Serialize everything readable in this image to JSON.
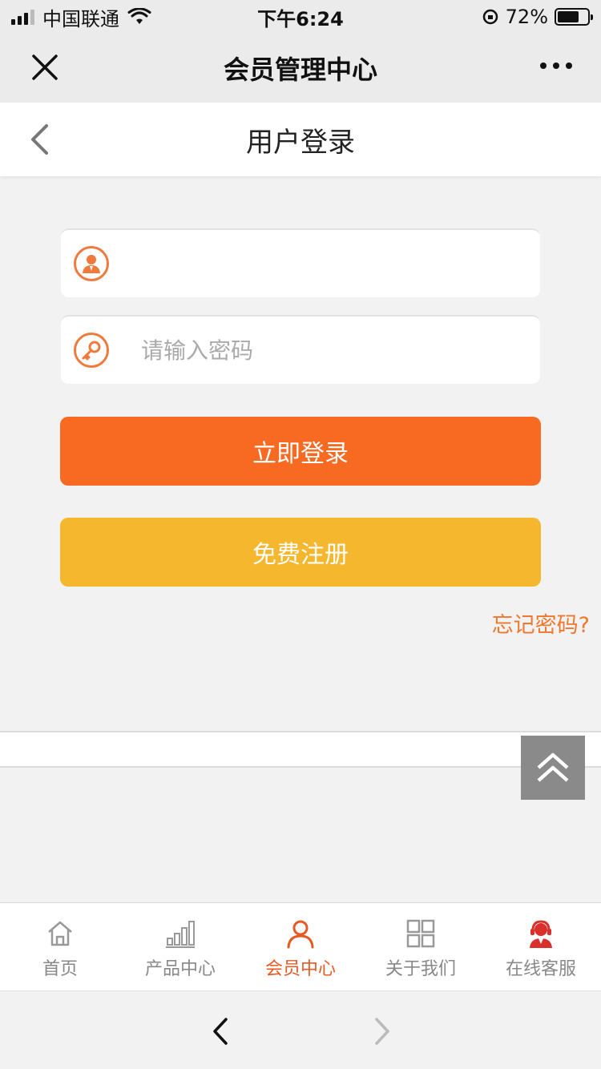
{
  "status_bar": {
    "carrier": "中国联通",
    "time": "下午6:24",
    "battery": "72%",
    "battery_level": 0.72
  },
  "wx_header": {
    "title": "会员管理中心"
  },
  "page": {
    "title": "用户登录"
  },
  "form": {
    "username_value": "",
    "password_placeholder": "请输入密码",
    "login_label": "立即登录",
    "register_label": "免费注册",
    "forgot_label": "忘记密码?"
  },
  "bottom_nav": {
    "items": [
      {
        "label": "首页",
        "icon": "home-icon"
      },
      {
        "label": "产品中心",
        "icon": "bar-chart-icon"
      },
      {
        "label": "会员中心",
        "icon": "user-icon"
      },
      {
        "label": "关于我们",
        "icon": "grid-icon"
      },
      {
        "label": "在线客服",
        "icon": "customer-service-icon"
      }
    ],
    "active_index": 2
  },
  "colors": {
    "accent": "#f86a22",
    "secondary": "#f5b72d",
    "link": "#f0782e"
  }
}
